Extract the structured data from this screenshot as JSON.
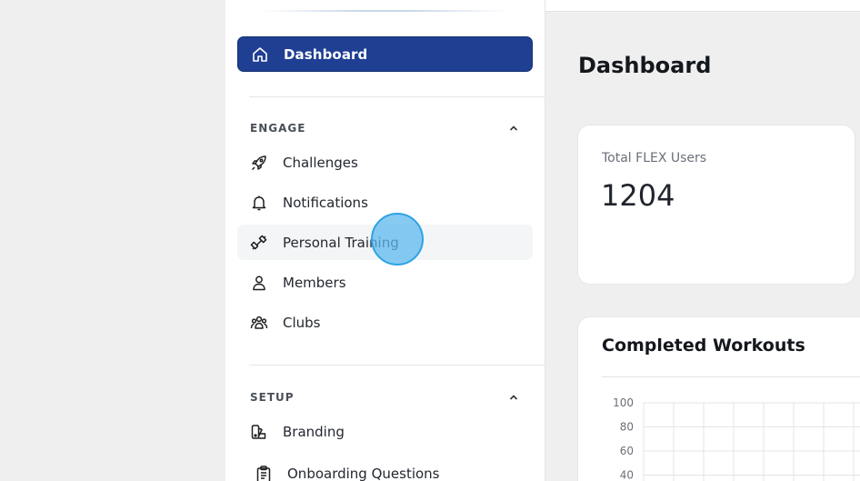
{
  "sidebar": {
    "active_item": {
      "label": "Dashboard",
      "icon": "home-icon"
    },
    "sections": [
      {
        "title": "ENGAGE",
        "items": [
          {
            "label": "Challenges",
            "icon": "rocket-icon"
          },
          {
            "label": "Notifications",
            "icon": "bell-icon"
          },
          {
            "label": "Personal Training",
            "icon": "dumbbell-icon"
          },
          {
            "label": "Members",
            "icon": "user-icon"
          },
          {
            "label": "Clubs",
            "icon": "group-icon"
          }
        ]
      },
      {
        "title": "SETUP",
        "items": [
          {
            "label": "Branding",
            "icon": "palette-icon"
          },
          {
            "label": "Onboarding Questions",
            "icon": "clipboard-icon"
          }
        ]
      }
    ]
  },
  "main": {
    "page_title": "Dashboard",
    "stat_card": {
      "label": "Total FLEX Users",
      "value": "1204"
    },
    "chart_card": {
      "title": "Completed Workouts"
    }
  },
  "chart_data": {
    "type": "line",
    "title": "Completed Workouts",
    "y_ticks": [
      "100",
      "80",
      "60",
      "40"
    ],
    "ylim": [
      0,
      100
    ],
    "grid": true
  },
  "colors": {
    "accent": "#1f3f93",
    "hover": "#f4f5f7",
    "cursor": "#2ea3e4"
  }
}
